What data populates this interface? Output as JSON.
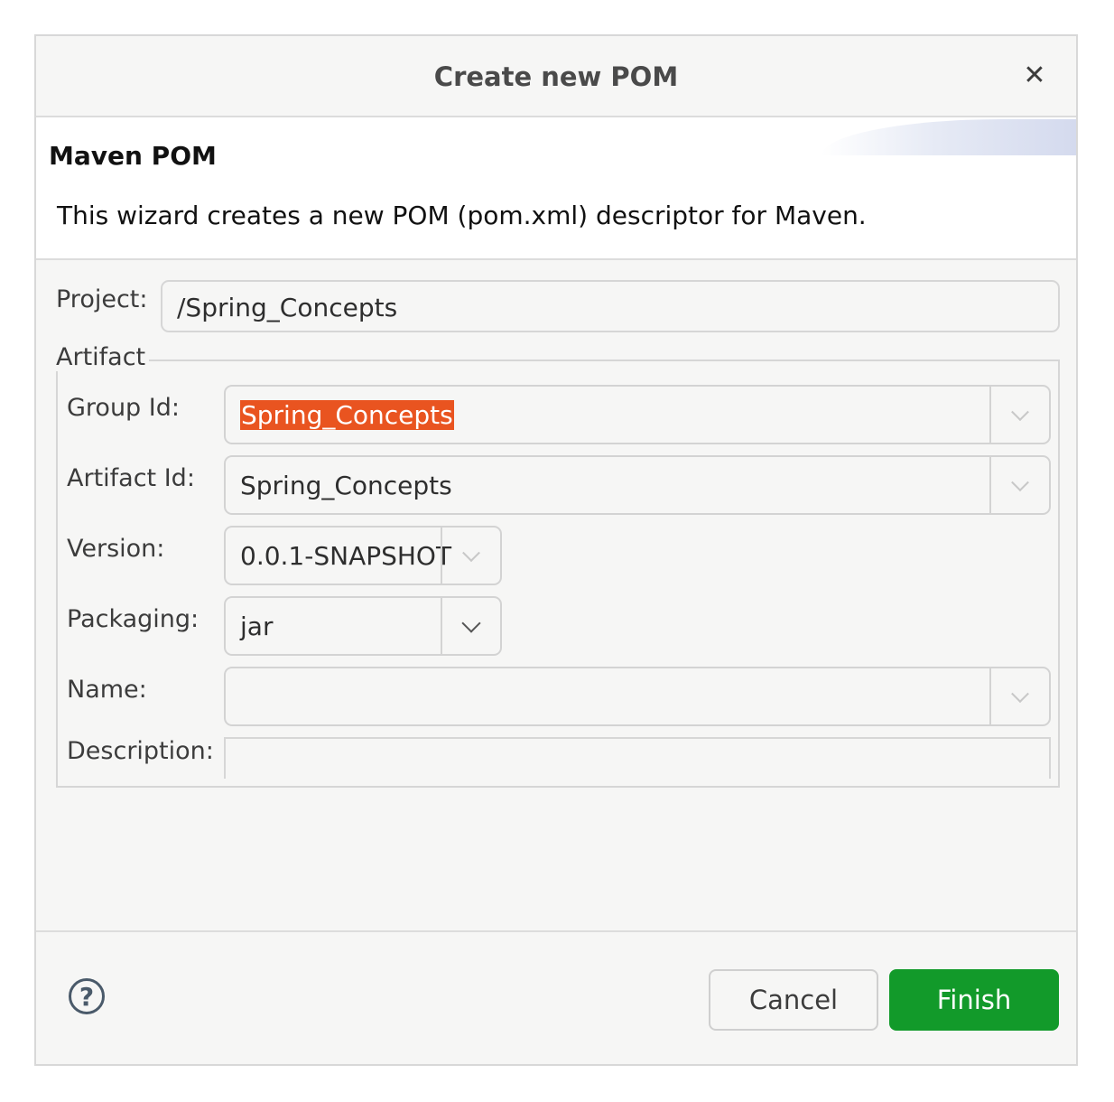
{
  "dialog": {
    "title": "Create new POM",
    "close_icon": "close-icon"
  },
  "banner": {
    "heading": "Maven POM",
    "description": "This wizard creates a new POM (pom.xml) descriptor for Maven."
  },
  "project": {
    "label": "Project:",
    "value": "/Spring_Concepts"
  },
  "artifact": {
    "legend": "Artifact",
    "group_id": {
      "label": "Group Id:",
      "value": "Spring_Concepts",
      "selected": true
    },
    "artifact_id": {
      "label": "Artifact Id:",
      "value": "Spring_Concepts"
    },
    "version": {
      "label": "Version:",
      "value": "0.0.1-SNAPSHOT"
    },
    "packaging": {
      "label": "Packaging:",
      "value": "jar"
    },
    "name": {
      "label": "Name:",
      "value": ""
    },
    "description": {
      "label": "Description:",
      "value": ""
    }
  },
  "footer": {
    "help_icon": "help-icon",
    "help_glyph": "?",
    "cancel_label": "Cancel",
    "finish_label": "Finish"
  },
  "colors": {
    "selection": "#e95420",
    "finish_button": "#129a2a",
    "dialog_bg": "#f6f6f5"
  }
}
